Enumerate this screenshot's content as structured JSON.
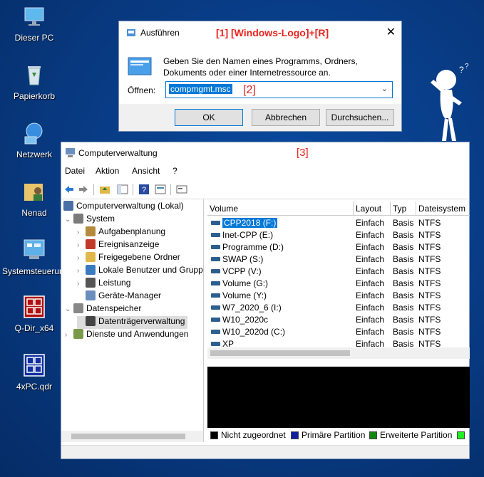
{
  "desktop": {
    "icons": [
      {
        "label": "Dieser PC",
        "icon": "this-pc-icon"
      },
      {
        "label": "Papierkorb",
        "icon": "recycle-bin-icon"
      },
      {
        "label": "Netzwerk",
        "icon": "network-icon"
      },
      {
        "label": "Nenad",
        "icon": "user-folder-icon"
      },
      {
        "label": "Systemsteuerung",
        "icon": "control-panel-icon"
      },
      {
        "label": "Q-Dir_x64",
        "icon": "qdir-icon"
      },
      {
        "label": "4xPC.qdr",
        "icon": "qdr-file-icon"
      }
    ]
  },
  "annotations": {
    "run_hint": "[1] [Windows-Logo]+[R]",
    "input_hint": "[2]",
    "window_hint": "[3]"
  },
  "run_dialog": {
    "title": "Ausführen",
    "close": "✕",
    "description": "Geben Sie den Namen eines Programms, Ordners, Dokuments oder einer Internetressource an.",
    "open_label": "Öffnen:",
    "open_value": "compmgmt.msc",
    "ok": "OK",
    "cancel": "Abbrechen",
    "browse": "Durchsuchen..."
  },
  "computer_management": {
    "title": "Computerverwaltung",
    "menu": [
      "Datei",
      "Aktion",
      "Ansicht",
      "?"
    ],
    "tree": [
      {
        "label": "Computerverwaltung (Lokal)",
        "level": 0,
        "expander": "",
        "color": "#4a6fa5"
      },
      {
        "label": "System",
        "level": 1,
        "expander": "⌄",
        "color": "#7a7a7a"
      },
      {
        "label": "Aufgabenplanung",
        "level": 2,
        "expander": "›",
        "color": "#b48a3c"
      },
      {
        "label": "Ereignisanzeige",
        "level": 2,
        "expander": "›",
        "color": "#c0392b"
      },
      {
        "label": "Freigegebene Ordner",
        "level": 2,
        "expander": "›",
        "color": "#e0b84a"
      },
      {
        "label": "Lokale Benutzer und Grupp",
        "level": 2,
        "expander": "›",
        "color": "#3a7abf"
      },
      {
        "label": "Leistung",
        "level": 2,
        "expander": "›",
        "color": "#555555"
      },
      {
        "label": "Geräte-Manager",
        "level": 2,
        "expander": "",
        "color": "#6a8fbf"
      },
      {
        "label": "Datenspeicher",
        "level": 1,
        "expander": "⌄",
        "color": "#888888"
      },
      {
        "label": "Datenträgerverwaltung",
        "level": 2,
        "expander": "",
        "color": "#444444"
      },
      {
        "label": "Dienste und Anwendungen",
        "level": 1,
        "expander": "›",
        "color": "#7a9a4a"
      }
    ],
    "columns": [
      "Volume",
      "Layout",
      "Typ",
      "Dateisystem"
    ],
    "volumes": [
      {
        "name": "CPP2018 (F:)",
        "layout": "Einfach",
        "type": "Basis",
        "fs": "NTFS"
      },
      {
        "name": "Inet-CPP (E:)",
        "layout": "Einfach",
        "type": "Basis",
        "fs": "NTFS"
      },
      {
        "name": "Programme (D:)",
        "layout": "Einfach",
        "type": "Basis",
        "fs": "NTFS"
      },
      {
        "name": "SWAP (S:)",
        "layout": "Einfach",
        "type": "Basis",
        "fs": "NTFS"
      },
      {
        "name": "VCPP (V:)",
        "layout": "Einfach",
        "type": "Basis",
        "fs": "NTFS"
      },
      {
        "name": "Volume (G:)",
        "layout": "Einfach",
        "type": "Basis",
        "fs": "NTFS"
      },
      {
        "name": "Volume (Y:)",
        "layout": "Einfach",
        "type": "Basis",
        "fs": "NTFS"
      },
      {
        "name": "W7_2020_6 (I:)",
        "layout": "Einfach",
        "type": "Basis",
        "fs": "NTFS"
      },
      {
        "name": "W10_2020c",
        "layout": "Einfach",
        "type": "Basis",
        "fs": "NTFS"
      },
      {
        "name": "W10_2020d (C:)",
        "layout": "Einfach",
        "type": "Basis",
        "fs": "NTFS"
      },
      {
        "name": "XP",
        "layout": "Einfach",
        "type": "Basis",
        "fs": "NTFS"
      }
    ],
    "legend": [
      {
        "label": "Nicht zugeordnet",
        "color": "#000000"
      },
      {
        "label": "Primäre Partition",
        "color": "#1020a0"
      },
      {
        "label": "Erweiterte Partition",
        "color": "#118811"
      },
      {
        "label": "",
        "color": "#22ee22"
      }
    ]
  }
}
